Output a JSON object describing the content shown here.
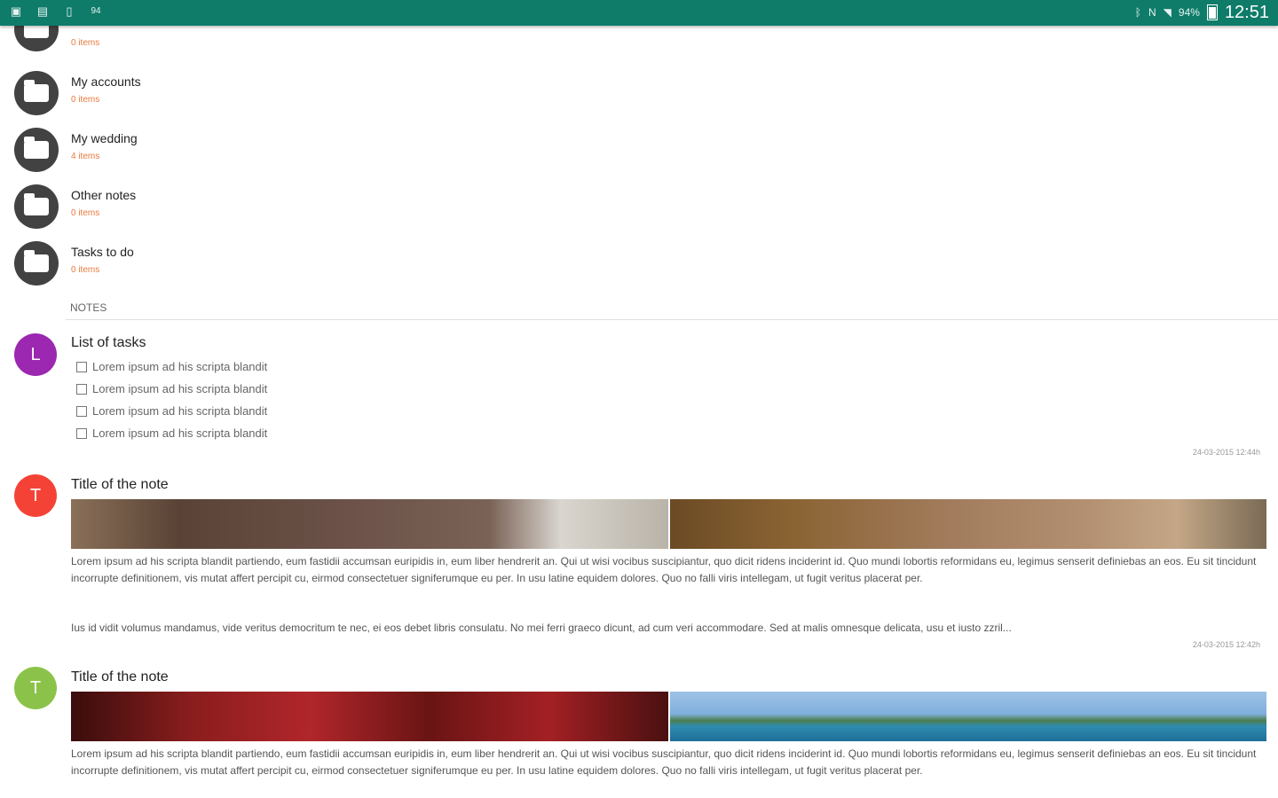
{
  "status_bar": {
    "left_icons": [
      "screenshot-icon",
      "gallery-icon",
      "sim-icon",
      "notification-icon"
    ],
    "left_text": "94",
    "right_icons": [
      "bluetooth-icon",
      "nfc-icon",
      "wifi-icon"
    ],
    "battery": "94%",
    "time": "12:51"
  },
  "folders": [
    {
      "title": "",
      "count": "0 items"
    },
    {
      "title": "My accounts",
      "count": "0 items"
    },
    {
      "title": "My wedding",
      "count": "4 items"
    },
    {
      "title": "Other notes",
      "count": "0 items"
    },
    {
      "title": "Tasks to do",
      "count": "0 items"
    }
  ],
  "section": {
    "label": "NOTES"
  },
  "notes": [
    {
      "title": "List of tasks",
      "avatar_letter": "L",
      "avatar_color": "#9c27b0",
      "tasks": [
        "Lorem ipsum ad his scripta blandit",
        "Lorem ipsum ad his scripta blandit",
        "Lorem ipsum ad his scripta blandit",
        "Lorem ipsum ad his scripta blandit"
      ],
      "timestamp": "24-03-2015 12:44h"
    },
    {
      "title": "Title of the note",
      "avatar_letter": "T",
      "avatar_color": "#f44336",
      "paragraph1": "Lorem ipsum ad his scripta blandit partiendo, eum fastidii accumsan euripidis in, eum liber hendrerit an. Qui ut wisi vocibus suscipiantur, quo dicit ridens inciderint id. Quo mundi lobortis reformidans eu, legimus senserit definiebas an eos. Eu sit tincidunt incorrupte definitionem, vis mutat affert percipit cu, eirmod consectetuer signiferumque eu per. In usu latine equidem dolores. Quo no falli viris intellegam, ut fugit veritus placerat per.",
      "paragraph2": "Ius id vidit volumus mandamus, vide veritus democritum te nec, ei eos debet libris consulatu. No mei ferri graeco dicunt, ad cum veri accommodare. Sed at malis omnesque delicata, usu et iusto zzril...",
      "timestamp": "24-03-2015 12:42h"
    },
    {
      "title": "Title of the note",
      "avatar_letter": "T",
      "avatar_color": "#8bc34a",
      "paragraph1": "Lorem ipsum ad his scripta blandit partiendo, eum fastidii accumsan euripidis in, eum liber hendrerit an. Qui ut wisi vocibus suscipiantur, quo dicit ridens inciderint id. Quo mundi lobortis reformidans eu, legimus senserit definiebas an eos. Eu sit tincidunt incorrupte definitionem, vis mutat affert percipit cu, eirmod consectetuer signiferumque eu per. In usu latine equidem dolores. Quo no falli viris intellegam, ut fugit veritus placerat per."
    }
  ],
  "colors": {
    "status_bar": "#0e7c69",
    "folder_icon": "#424242",
    "item_count": "#e87a3d"
  }
}
